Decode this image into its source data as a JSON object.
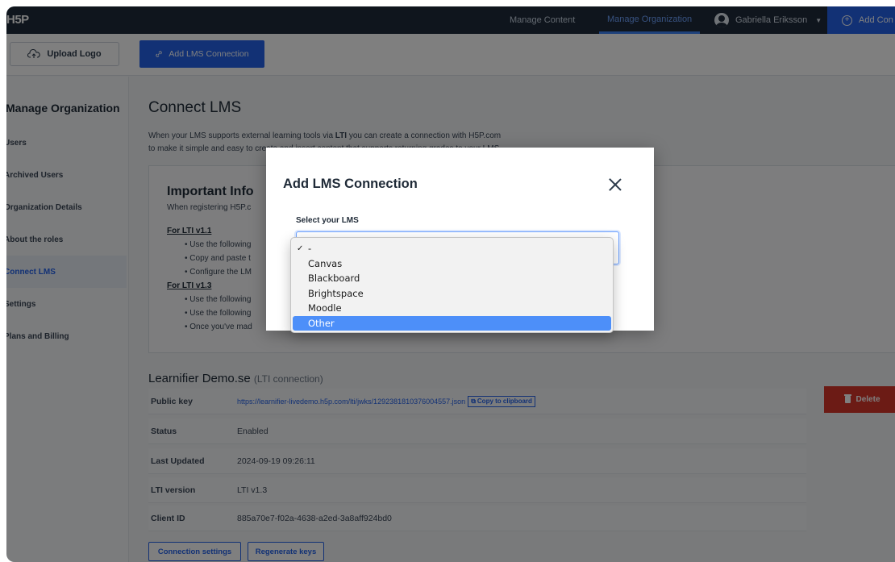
{
  "topbar": {
    "logo": "H5P",
    "nav_manage_content": "Manage Content",
    "nav_manage_organization": "Manage Organization",
    "user_name": "Gabriella Eriksson",
    "add_content": "Add Con"
  },
  "toolbar": {
    "upload_logo": "Upload Logo",
    "add_lms_connection": "Add LMS Connection"
  },
  "sidebar": {
    "title": "Manage Organization",
    "items": [
      {
        "label": "Users"
      },
      {
        "label": "Archived Users"
      },
      {
        "label": "Organization Details"
      },
      {
        "label": "About the roles"
      },
      {
        "label": "Connect LMS"
      },
      {
        "label": "Settings"
      },
      {
        "label": "Plans and Billing"
      }
    ]
  },
  "main": {
    "title": "Connect LMS",
    "intro_line1_pre": "When your LMS supports external learning tools via ",
    "intro_line1_bold": "LTI",
    "intro_line1_post": " you can create a connection with H5P.com",
    "intro_line2": "to make it simple and easy to create and insert content that supports returning grades to your LMS.",
    "info": {
      "title": "Important Info",
      "subtitle": "When registering H5P.c",
      "lti11_head": "For LTI v1.1",
      "lti11_bullets": [
        "• Use the following",
        "• Copy and paste t",
        "• Configure the LM"
      ],
      "lti13_head": "For LTI v1.3",
      "lti13_bullets": [
        "• Use the following",
        "• Use the following",
        "• Once you've mad"
      ]
    },
    "connection": {
      "name": "Learnifier Demo.se",
      "type": "(LTI connection)",
      "public_key_label": "Public key",
      "public_key_value": "https://learnifier-livedemo.h5p.com/lti/jwks/1292381810376004557.json",
      "copy_label": "Copy to clipboard",
      "status_label": "Status",
      "status_value": "Enabled",
      "updated_label": "Last Updated",
      "updated_value": "2024-09-19 09:26:11",
      "version_label": "LTI version",
      "version_value": "LTI v1.3",
      "client_label": "Client ID",
      "client_value": "885a70e7-f02a-4638-a2ed-3a8aff924bd0",
      "delete_label": "Delete",
      "settings_button": "Connection settings",
      "regenerate_button": "Regenerate keys"
    }
  },
  "modal": {
    "title": "Add LMS Connection",
    "select_label": "Select your LMS",
    "options": [
      "-",
      "Canvas",
      "Blackboard",
      "Brightspace",
      "Moodle",
      "Other"
    ],
    "checked_option": "-",
    "highlighted_option": "Other"
  },
  "colors": {
    "topbar": "#1e2b3b",
    "primary": "#2563eb",
    "danger": "#d9362b",
    "dropdown_highlight": "#4d8ff9"
  }
}
